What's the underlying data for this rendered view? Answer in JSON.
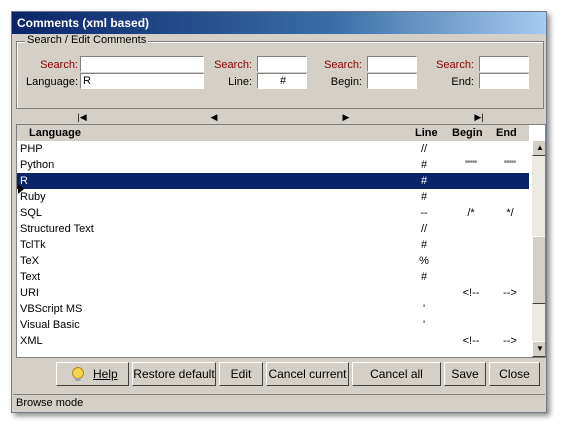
{
  "window": {
    "title": "Comments (xml based)"
  },
  "search": {
    "group_label": "Search / Edit Comments",
    "language_search_label": "Search:",
    "language_label": "Language:",
    "language_search_value": "",
    "language_value": "R",
    "line_search_label": "Search:",
    "line_label": "Line:",
    "line_search_value": "",
    "line_value": "#",
    "begin_search_label": "Search:",
    "begin_label": "Begin:",
    "begin_search_value": "",
    "begin_value": "",
    "end_search_label": "Search:",
    "end_label": "End:",
    "end_search_value": "",
    "end_value": ""
  },
  "nav": {
    "first": "|◀",
    "prev": "◀",
    "next": "▶",
    "last": "▶|"
  },
  "table": {
    "columns": [
      "Language",
      "Line",
      "Begin",
      "End"
    ],
    "selected_index": 2,
    "rows": [
      {
        "language": "PHP",
        "line": "//",
        "begin": "",
        "end": ""
      },
      {
        "language": "Python",
        "line": "#",
        "begin": "\"\"\"",
        "end": "\"\"\""
      },
      {
        "language": "R",
        "line": "#",
        "begin": "",
        "end": ""
      },
      {
        "language": "Ruby",
        "line": "#",
        "begin": "",
        "end": ""
      },
      {
        "language": "SQL",
        "line": "--",
        "begin": "/*",
        "end": "*/"
      },
      {
        "language": "Structured Text",
        "line": "//",
        "begin": "",
        "end": ""
      },
      {
        "language": "TclTk",
        "line": "#",
        "begin": "",
        "end": ""
      },
      {
        "language": "TeX",
        "line": "%",
        "begin": "",
        "end": ""
      },
      {
        "language": "Text",
        "line": "#",
        "begin": "",
        "end": ""
      },
      {
        "language": "URI",
        "line": "",
        "begin": "<!--",
        "end": "-->"
      },
      {
        "language": "VBScript MS",
        "line": "'",
        "begin": "",
        "end": ""
      },
      {
        "language": "Visual Basic",
        "line": "'",
        "begin": "",
        "end": ""
      },
      {
        "language": "XML",
        "line": "",
        "begin": "<!--",
        "end": "-->"
      }
    ]
  },
  "buttons": {
    "help": "Help",
    "restore_default": "Restore default",
    "edit": "Edit",
    "cancel_current": "Cancel current",
    "cancel_all": "Cancel all",
    "save": "Save",
    "close": "Close"
  },
  "status": {
    "text": "Browse mode"
  },
  "colors": {
    "selection": "#0a246a",
    "label_red": "#8b0000",
    "face": "#d4d0c8"
  }
}
